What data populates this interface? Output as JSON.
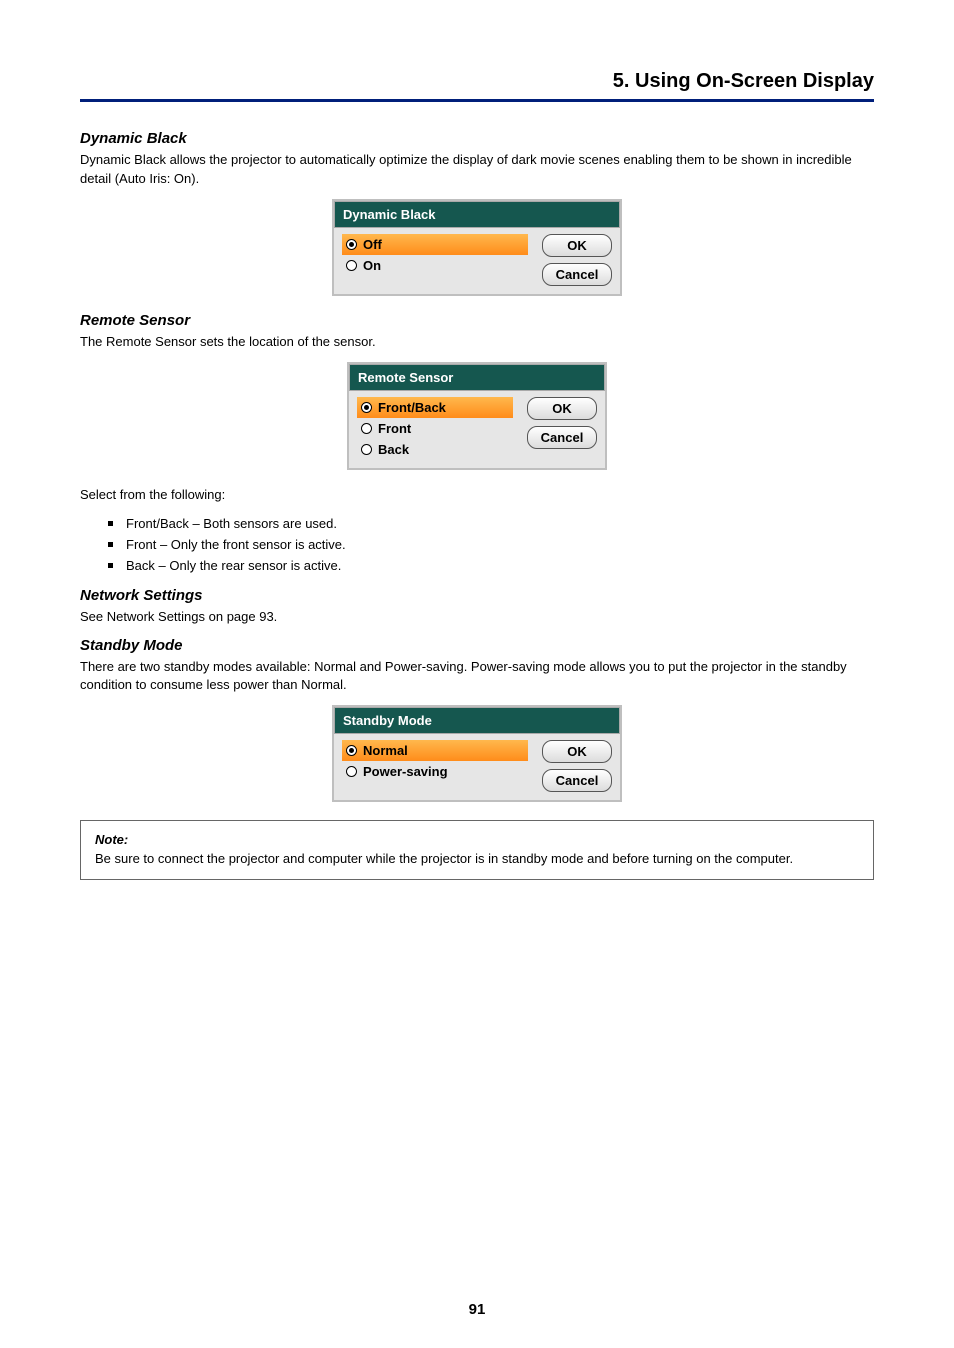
{
  "header": {
    "chapter_title": "5. Using On-Screen Display"
  },
  "sections": {
    "dynamic_black": {
      "heading": "Dynamic Black",
      "p1": "Dynamic Black allows the projector to automatically optimize the display of dark movie scenes enabling them to be shown in incredible detail (Auto Iris: On).",
      "osd": {
        "title": "Dynamic Black",
        "opt_off": "Off",
        "opt_on": "On",
        "ok": "OK",
        "cancel": "Cancel"
      }
    },
    "remote_sensor": {
      "heading": "Remote Sensor",
      "p1": "The Remote Sensor sets the location of the sensor.",
      "osd": {
        "title": "Remote Sensor",
        "opt_fb": "Front/Back",
        "opt_front": "Front",
        "opt_back": "Back",
        "ok": "OK",
        "cancel": "Cancel"
      },
      "after": "Select from the following:",
      "items": {
        "i1": "Front/Back – Both sensors are used.",
        "i2": "Front – Only the front sensor is active.",
        "i3": "Back – Only the rear sensor is active."
      }
    },
    "network_settings": {
      "heading": "Network Settings",
      "p1": "See Network Settings on page 93."
    },
    "standby_mode": {
      "heading": "Standby Mode",
      "p1": "There are two standby modes available: Normal and Power-saving. Power-saving mode allows you to put the projector in the standby condition to consume less power than Normal.",
      "osd": {
        "title": "Standby Mode",
        "opt_normal": "Normal",
        "opt_ps": "Power-saving",
        "ok": "OK",
        "cancel": "Cancel"
      }
    },
    "note": {
      "label": "Note:",
      "text": "Be sure to connect the projector and computer while the projector is in standby mode and before turning on the computer."
    }
  },
  "page_number": "91"
}
